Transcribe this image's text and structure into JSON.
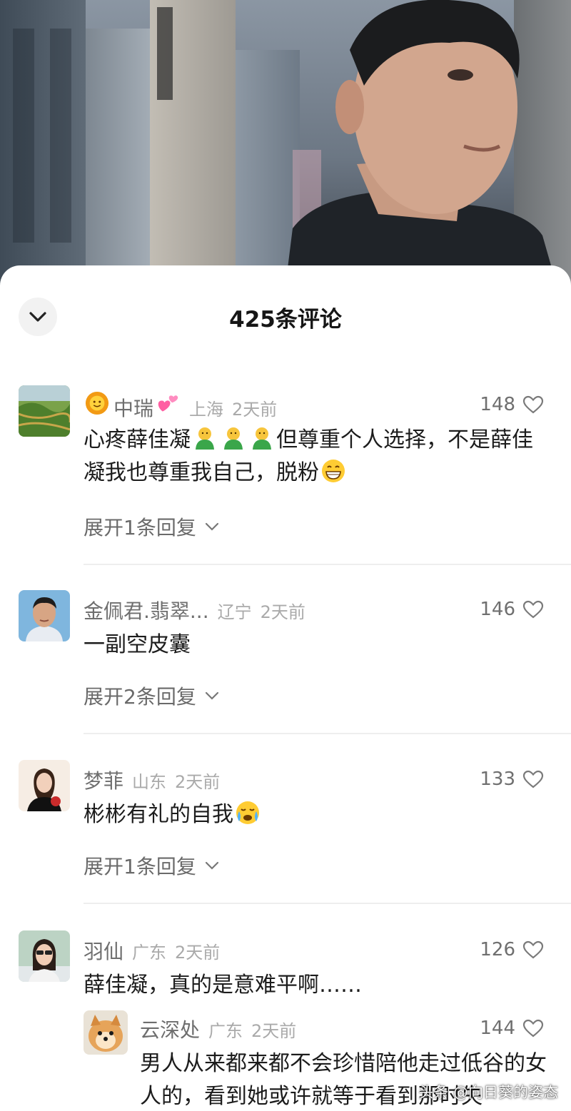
{
  "sheet": {
    "title": "425条评论"
  },
  "comments": [
    {
      "name": "中瑞",
      "location": "上海",
      "time": "2天前",
      "likes": "148",
      "text_a": "心疼薛佳凝",
      "text_b": "但尊重个人选择，不是薛佳凝我也尊重我自己，脱粉",
      "expand": "展开1条回复"
    },
    {
      "name": "金佩君.翡翠...",
      "location": "辽宁",
      "time": "2天前",
      "likes": "146",
      "text": "一副空皮囊",
      "expand": "展开2条回复"
    },
    {
      "name": "梦菲",
      "location": "山东",
      "time": "2天前",
      "likes": "133",
      "text": "彬彬有礼的自我",
      "expand": "展开1条回复"
    },
    {
      "name": "羽仙",
      "location": "广东",
      "time": "2天前",
      "likes": "126",
      "text": "薛佳凝，真的是意难平啊……"
    }
  ],
  "reply": {
    "name": "云深处",
    "location": "广东",
    "time": "2天前",
    "likes": "144",
    "text": "男人从来都来都不会珍惜陪他走过低谷的女人的，看到她或许就等于看到那时失"
  },
  "watermark": "头条 @向日葵的姿态",
  "colors": {
    "like_icon": "#7a7a7a",
    "secondary_text": "#6e6e6e",
    "location_text": "#aaaaaa"
  },
  "icons": {
    "collapse": "chevron-down-icon",
    "like": "heart-outline-icon",
    "expand": "chevron-down-icon"
  }
}
